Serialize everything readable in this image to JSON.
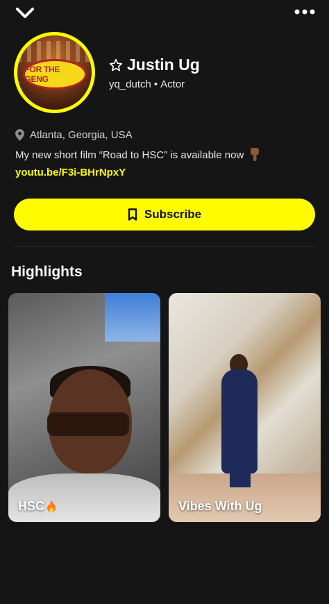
{
  "header": {
    "back_icon": "chevron-down-icon",
    "more_icon": "more-dots-icon"
  },
  "profile": {
    "avatar_text": "FOR THE GENG",
    "name_star_icon": "star-outline-icon",
    "name": "Justin Ug",
    "username": "yq_dutch",
    "separator": "•",
    "category": "Actor",
    "location_icon": "location-pin-icon",
    "location": "Atlanta, Georgia, USA",
    "bio": "My new short film “Road to HSC” is available now",
    "bio_emoji_icon": "pointing-down-hand-icon",
    "link": "youtu.be/F3i-BHrNpxY"
  },
  "subscribe": {
    "icon": "bookmark-icon",
    "label": "Subscribe",
    "bg_color": "#FFFC00"
  },
  "highlights": {
    "title": "Highlights",
    "items": [
      {
        "label": "HSC",
        "emoji_icon": "fire-icon"
      },
      {
        "label": "Vibes With Ug"
      }
    ]
  }
}
